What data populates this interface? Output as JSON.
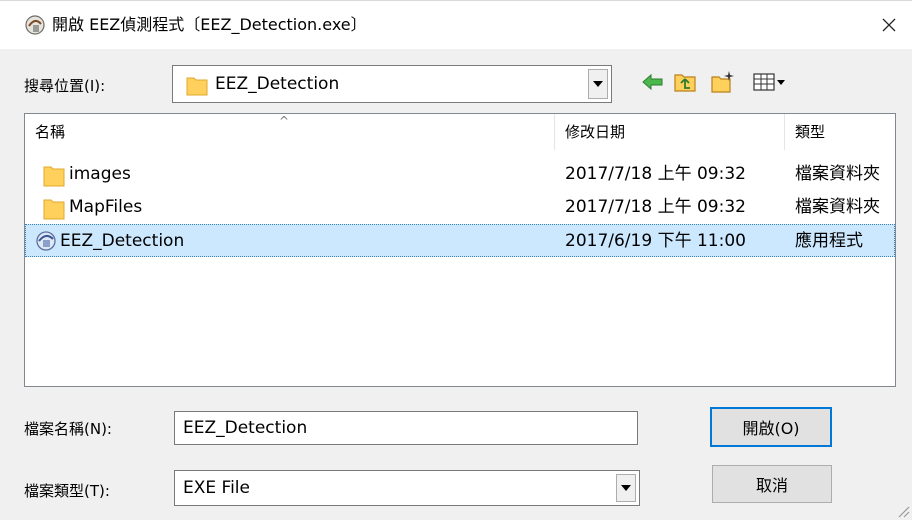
{
  "window": {
    "title": "開啟 EEZ偵測程式〔EEZ_Detection.exe〕",
    "icon": "app-icon",
    "close_glyph": "✕"
  },
  "look_in": {
    "label": "搜尋位置(I):",
    "value": "EEZ_Detection",
    "toolbar": [
      "back-icon",
      "up-folder-icon",
      "new-folder-icon",
      "view-menu-icon"
    ]
  },
  "file_list": {
    "columns": [
      "名稱",
      "修改日期",
      "類型"
    ],
    "rows": [
      {
        "name": "images",
        "date": "2017/7/18 上午 09:32",
        "type": "檔案資料夾",
        "icon": "folder-icon",
        "selected": false
      },
      {
        "name": "MapFiles",
        "date": "2017/7/18 上午 09:32",
        "type": "檔案資料夾",
        "icon": "folder-icon",
        "selected": false
      },
      {
        "name": "EEZ_Detection",
        "date": "2017/6/19 下午 11:00",
        "type": "應用程式",
        "icon": "exe-icon",
        "selected": true
      }
    ],
    "sort_indicator": "^",
    "scroll_left": "<",
    "scroll_right": ">"
  },
  "file_name": {
    "label": "檔案名稱(N):",
    "value": "EEZ_Detection"
  },
  "file_type": {
    "label": "檔案類型(T):",
    "value": "EXE File"
  },
  "buttons": {
    "open": "開啟(O)",
    "cancel": "取消"
  },
  "colors": {
    "selection_bg": "#cce8ff",
    "folder": "#ffd15c",
    "default_button_border": "#0078d7"
  }
}
